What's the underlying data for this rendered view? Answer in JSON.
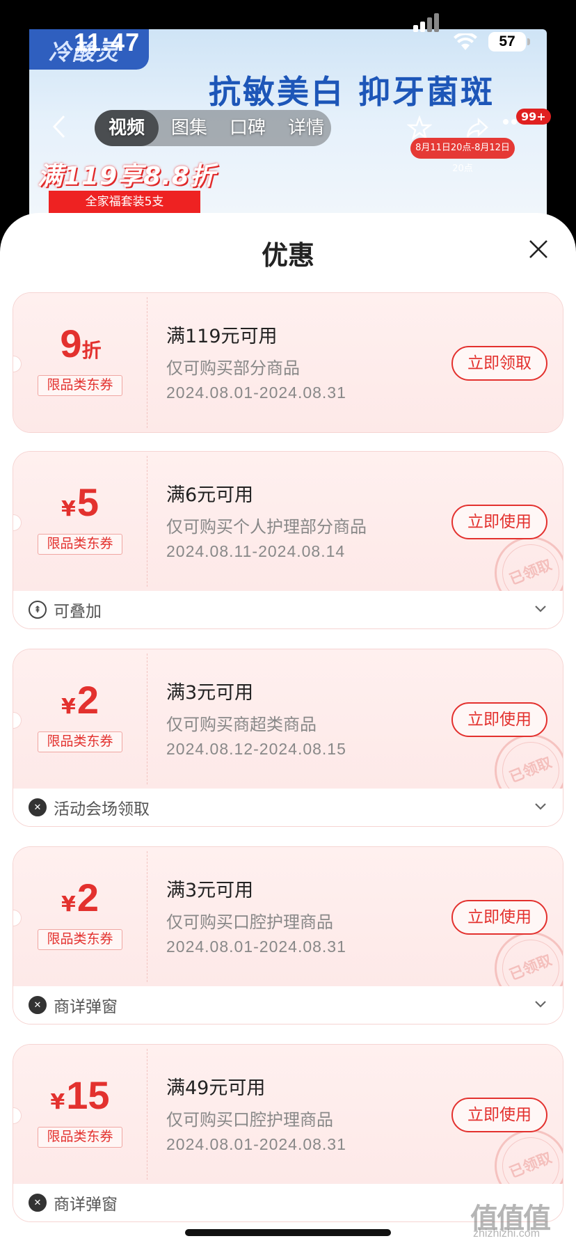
{
  "status_bar": {
    "time": "11:47",
    "battery": "57"
  },
  "banner": {
    "brand": "冷酸灵",
    "headline": "抗敏美白 抑牙菌斑",
    "promo": "满119享8.8折",
    "promo_sub": "全家福套装5支",
    "promo_tag": "8月11日20点-8月12日20点",
    "cart_badge": "99+"
  },
  "tabs": [
    {
      "label": "视频"
    },
    {
      "label": "图集"
    },
    {
      "label": "口碑"
    },
    {
      "label": "详情"
    }
  ],
  "sheet": {
    "title": "优惠"
  },
  "coupons": [
    {
      "currency": "",
      "amount": "9",
      "unit": "折",
      "tag": "限品类东券",
      "title": "满119元可用",
      "desc": "仅可购买部分商品",
      "date": "2024.08.01-2024.08.31",
      "button": "立即领取",
      "stamp": "",
      "footer": ""
    },
    {
      "currency": "¥",
      "amount": "5",
      "unit": "",
      "tag": "限品类东券",
      "title": "满6元可用",
      "desc": "仅可购买个人护理部分商品",
      "date": "2024.08.11-2024.08.14",
      "button": "立即使用",
      "stamp": "已领取",
      "footer": "可叠加"
    },
    {
      "currency": "¥",
      "amount": "2",
      "unit": "",
      "tag": "限品类东券",
      "title": "满3元可用",
      "desc": "仅可购买商超类商品",
      "date": "2024.08.12-2024.08.15",
      "button": "立即使用",
      "stamp": "已领取",
      "footer": "活动会场领取"
    },
    {
      "currency": "¥",
      "amount": "2",
      "unit": "",
      "tag": "限品类东券",
      "title": "满3元可用",
      "desc": "仅可购买口腔护理商品",
      "date": "2024.08.01-2024.08.31",
      "button": "立即使用",
      "stamp": "已领取",
      "footer": "商详弹窗"
    },
    {
      "currency": "¥",
      "amount": "15",
      "unit": "",
      "tag": "限品类东券",
      "title": "满49元可用",
      "desc": "仅可购买口腔护理商品",
      "date": "2024.08.01-2024.08.31",
      "button": "立即使用",
      "stamp": "已领取",
      "footer": "商详弹窗"
    }
  ],
  "watermark": {
    "main": "值值值",
    "sub": "zhizhizhi.com"
  },
  "colors": {
    "accent": "#e3312e",
    "coupon_bg": "#fdeceb"
  }
}
